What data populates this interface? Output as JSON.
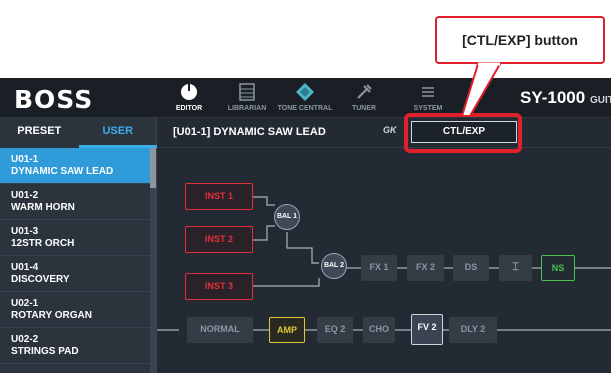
{
  "callout": {
    "label": "[CTL/EXP] button"
  },
  "app": {
    "logo": "BOSS",
    "model": "SY-1000",
    "model_suffix": "GUITAR",
    "nav": [
      {
        "label": "EDITOR",
        "icon": "editor-icon",
        "active": true
      },
      {
        "label": "LIBRARIAN",
        "icon": "librarian-icon",
        "active": false
      },
      {
        "label": "TONE CENTRAL",
        "icon": "tone-central-icon",
        "active": false
      },
      {
        "label": "TUNER",
        "icon": "tuner-icon",
        "active": false
      },
      {
        "label": "SYSTEM",
        "icon": "menu-icon",
        "active": false
      }
    ]
  },
  "sidebar": {
    "tabs": [
      {
        "label": "PRESET",
        "active": false
      },
      {
        "label": "USER",
        "active": true
      }
    ],
    "items": [
      {
        "id": "U01-1",
        "name": "DYNAMIC SAW LEAD",
        "selected": true
      },
      {
        "id": "U01-2",
        "name": "WARM HORN",
        "selected": false
      },
      {
        "id": "U01-3",
        "name": "12STR ORCH",
        "selected": false
      },
      {
        "id": "U01-4",
        "name": "DISCOVERY",
        "selected": false
      },
      {
        "id": "U02-1",
        "name": "ROTARY ORGAN",
        "selected": false
      },
      {
        "id": "U02-2",
        "name": "STRINGS PAD",
        "selected": false
      }
    ]
  },
  "main": {
    "patch_title": "[U01-1]  DYNAMIC SAW LEAD",
    "gk_label": "GK",
    "ctl_button": "CTL/EXP",
    "chain": {
      "inst1": "INST 1",
      "inst2": "INST 2",
      "inst3": "INST 3",
      "bal1": "BAL 1",
      "bal2": "BAL 2",
      "fx1": "FX 1",
      "fx2": "FX 2",
      "ds": "DS",
      "ns": "NS",
      "normal": "NORMAL",
      "amp": "AMP",
      "eq2": "EQ 2",
      "cho": "CHO",
      "fv2": "FV 2",
      "dly2": "DLY 2"
    }
  },
  "colors": {
    "accent": "#2f9bd8",
    "inst": "#e0303a",
    "amp": "#e0c63a",
    "ns": "#48c24e",
    "callout": "#e0202a"
  }
}
